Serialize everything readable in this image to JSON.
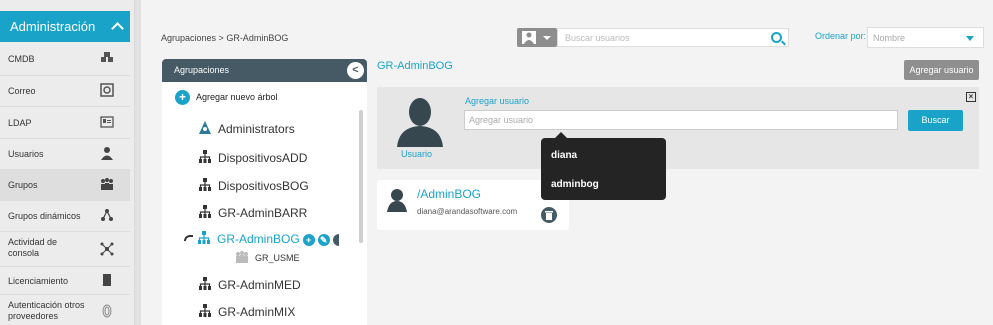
{
  "sidebar": {
    "header": "Administración",
    "items": [
      {
        "label": "CMDB"
      },
      {
        "label": "Correo"
      },
      {
        "label": "LDAP"
      },
      {
        "label": "Usuarios"
      },
      {
        "label": "Grupos"
      },
      {
        "label": "Grupos dinámicos"
      },
      {
        "label": "Actividad de consola"
      },
      {
        "label": "Licenciamiento"
      },
      {
        "label": "Autenticación otros proveedores"
      }
    ]
  },
  "breadcrumb": {
    "root": "Agrupaciones",
    "sep": " > ",
    "current": "GR-AdminBOG"
  },
  "search": {
    "placeholder": "Buscar usuarios"
  },
  "order": {
    "label": "Ordenar por:",
    "value": "Nombre"
  },
  "tree": {
    "header": "Agrupaciones",
    "collapse_glyph": "<",
    "add_label": "Agregar nuevo árbol",
    "nodes": [
      {
        "label": "Administrators"
      },
      {
        "label": "DispositivosADD"
      },
      {
        "label": "DispositivosBOG"
      },
      {
        "label": "GR-AdminBARR"
      },
      {
        "label": "GR-AdminBOG"
      },
      {
        "label": "GR-AdminMED"
      },
      {
        "label": "GR-AdminMIX"
      }
    ],
    "subnode": "GR_USME"
  },
  "group": {
    "title": "GR-AdminBOG",
    "add_user_button": "Agregar usuario"
  },
  "add_panel": {
    "avatar_label": "Usuario",
    "title": "Agregar usuario",
    "input_placeholder": "Agregar usuario",
    "search_button": "Buscar",
    "close_glyph": "×"
  },
  "dropdown": {
    "options": [
      "diana",
      "adminbog"
    ]
  },
  "user_card": {
    "name": "/AdminBOG",
    "email": "diana@arandasoftware.com"
  },
  "colors": {
    "accent": "#1aa3c9",
    "dark": "#455a64"
  }
}
